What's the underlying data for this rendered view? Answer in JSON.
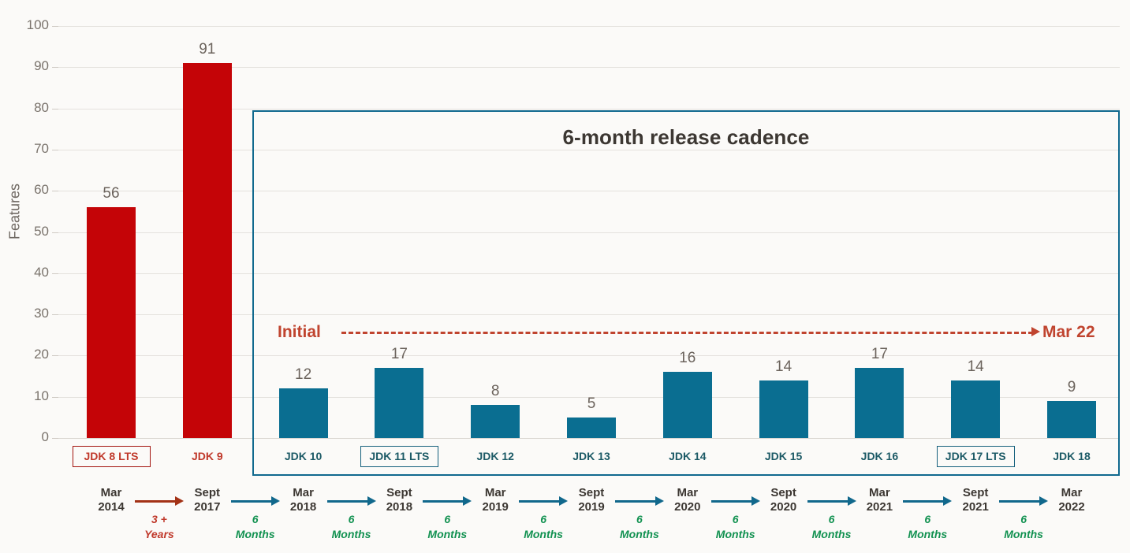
{
  "chart_data": {
    "type": "bar",
    "title": "6-month release cadence",
    "xlabel": "",
    "ylabel": "Features",
    "ylim": [
      0,
      100
    ],
    "ytick_step": 10,
    "yticks": [
      "0",
      "10",
      "20",
      "30",
      "40",
      "50",
      "60",
      "70",
      "80",
      "90",
      "100"
    ],
    "grid": true,
    "legend": "none",
    "categories": [
      "JDK 8 LTS",
      "JDK 9",
      "JDK 10",
      "JDK 11 LTS",
      "JDK 12",
      "JDK 13",
      "JDK 14",
      "JDK 15",
      "JDK 16",
      "JDK 17 LTS",
      "JDK 18"
    ],
    "values": [
      56,
      91,
      12,
      17,
      8,
      5,
      16,
      14,
      17,
      14,
      9
    ],
    "colors": [
      "#c40407",
      "#c40407",
      "#0a6e91",
      "#0a6e91",
      "#0a6e91",
      "#0a6e91",
      "#0a6e91",
      "#0a6e91",
      "#0a6e91",
      "#0a6e91",
      "#0a6e91"
    ],
    "annotations": {
      "initial": "Initial",
      "end": "Mar 22",
      "cadence_title": "6-month release cadence"
    }
  },
  "axis": {
    "y_title": "Features",
    "ticks": [
      "100",
      "90",
      "80",
      "70",
      "60",
      "50",
      "40",
      "30",
      "20",
      "10",
      "0"
    ]
  },
  "bars": [
    {
      "label": "JDK 8 LTS",
      "value": "56",
      "lts": true,
      "color": "red"
    },
    {
      "label": "JDK 9",
      "value": "91",
      "lts": false,
      "color": "red"
    },
    {
      "label": "JDK 10",
      "value": "12",
      "lts": false,
      "color": "blue"
    },
    {
      "label": "JDK 11 LTS",
      "value": "17",
      "lts": true,
      "color": "blue"
    },
    {
      "label": "JDK 12",
      "value": "8",
      "lts": false,
      "color": "blue"
    },
    {
      "label": "JDK 13",
      "value": "5",
      "lts": false,
      "color": "blue"
    },
    {
      "label": "JDK 14",
      "value": "16",
      "lts": false,
      "color": "blue"
    },
    {
      "label": "JDK 15",
      "value": "14",
      "lts": false,
      "color": "blue"
    },
    {
      "label": "JDK 16",
      "value": "17",
      "lts": false,
      "color": "blue"
    },
    {
      "label": "JDK 17 LTS",
      "value": "14",
      "lts": true,
      "color": "blue"
    },
    {
      "label": "JDK 18",
      "value": "9",
      "lts": false,
      "color": "blue"
    }
  ],
  "cadence": {
    "title": "6-month release cadence",
    "border_color": "#10698e"
  },
  "initial_arrow": {
    "start_label": "Initial",
    "end_label": "Mar 22",
    "color": "#c0442f"
  },
  "timeline": {
    "dates": [
      {
        "month": "Mar",
        "year": "2014"
      },
      {
        "month": "Sept",
        "year": "2017"
      },
      {
        "month": "Mar",
        "year": "2018"
      },
      {
        "month": "Sept",
        "year": "2018"
      },
      {
        "month": "Mar",
        "year": "2019"
      },
      {
        "month": "Sept",
        "year": "2019"
      },
      {
        "month": "Mar",
        "year": "2020"
      },
      {
        "month": "Sept",
        "year": "2020"
      },
      {
        "month": "Mar",
        "year": "2021"
      },
      {
        "month": "Sept",
        "year": "2021"
      },
      {
        "month": "Mar",
        "year": "2022"
      }
    ],
    "gaps": [
      {
        "num": "3 +",
        "unit": "Years",
        "color": "red"
      },
      {
        "num": "6",
        "unit": "Months",
        "color": "green"
      },
      {
        "num": "6",
        "unit": "Months",
        "color": "green"
      },
      {
        "num": "6",
        "unit": "Months",
        "color": "green"
      },
      {
        "num": "6",
        "unit": "Months",
        "color": "green"
      },
      {
        "num": "6",
        "unit": "Months",
        "color": "green"
      },
      {
        "num": "6",
        "unit": "Months",
        "color": "green"
      },
      {
        "num": "6",
        "unit": "Months",
        "color": "green"
      },
      {
        "num": "6",
        "unit": "Months",
        "color": "green"
      },
      {
        "num": "6",
        "unit": "Months",
        "color": "green"
      }
    ]
  },
  "colors": {
    "background": "#fbfaf8",
    "red_bar": "#c40407",
    "blue_bar": "#0a6e91",
    "grid": "#e4e1dd",
    "tick_text": "#7a736c",
    "value_text": "#6b635c",
    "title_text": "#3c3732",
    "accent_red": "#c0392b",
    "accent_green": "#119150",
    "accent_blue": "#11688c"
  }
}
